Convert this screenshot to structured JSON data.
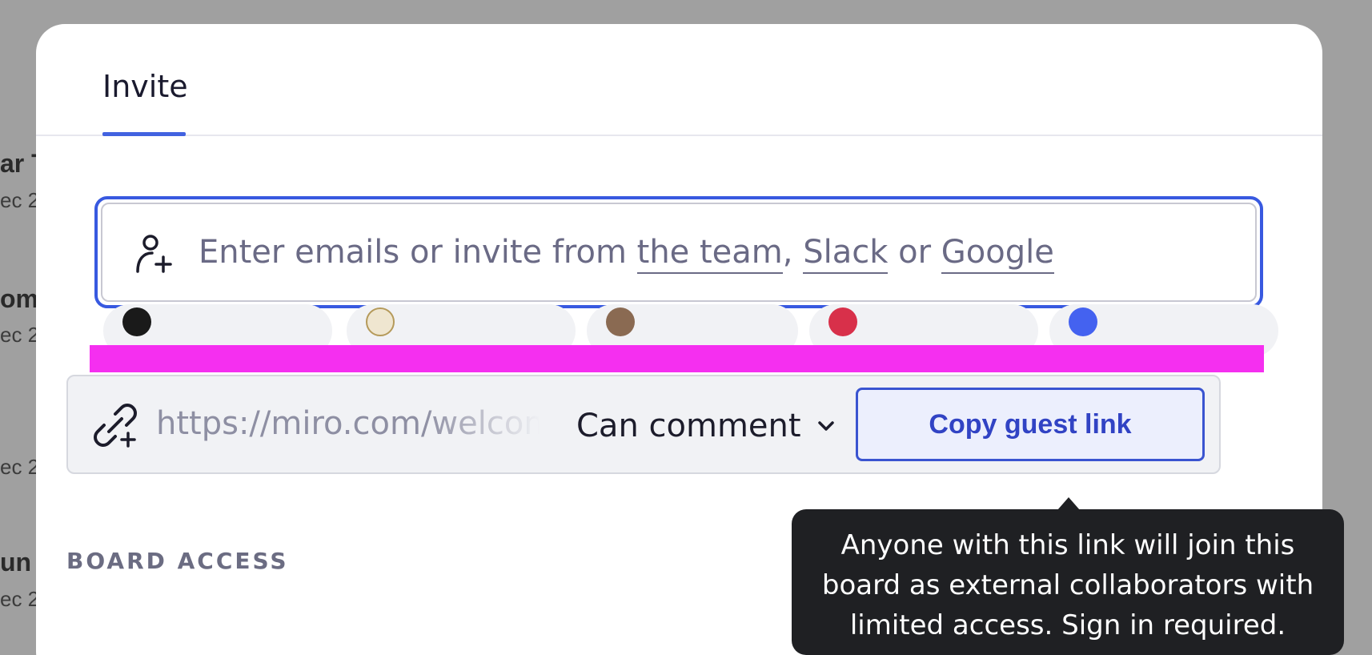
{
  "background": {
    "items": [
      {
        "title": "ar T",
        "sub": "ec 2"
      },
      {
        "title": "om:",
        "sub": "ec 2"
      },
      {
        "title": "",
        "sub": "ec 2"
      },
      {
        "title": "un",
        "sub": "ec 2"
      }
    ]
  },
  "modal": {
    "tab_invite": "Invite",
    "email": {
      "prefix": "Enter emails or invite from ",
      "link_team": "the team",
      "sep1": ", ",
      "link_slack": "Slack",
      "sep2": " or ",
      "link_google": "Google"
    },
    "link_row": {
      "url": "https://miro.com/welcome",
      "permission": "Can comment",
      "copy_button": "Copy guest link"
    },
    "board_access_heading": "BOARD ACCESS",
    "tooltip": "Anyone with this link will join this board as external collaborators with limited access. Sign in required."
  },
  "colors": {
    "accent": "#3859e0",
    "redaction": "#f52ff0",
    "tooltip_bg": "#1f2023"
  },
  "icons": [
    "person-add-icon",
    "link-add-icon",
    "chevron-down-icon"
  ]
}
